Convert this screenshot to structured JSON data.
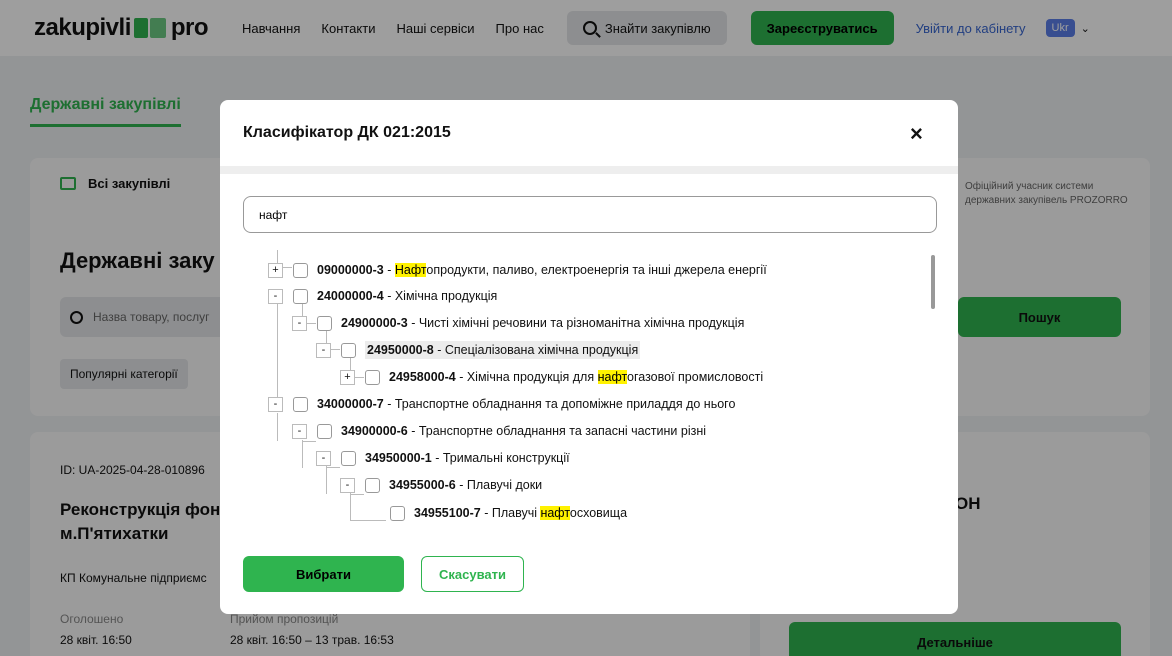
{
  "header": {
    "logo_left": "zakupivli",
    "logo_right": "pro",
    "nav": [
      "Навчання",
      "Контакти",
      "Наші сервіси",
      "Про нас"
    ],
    "find_button": "Знайти закупівлю",
    "register_button": "Зареєструватись",
    "login_link": "Увійти до кабінету",
    "language": "Ukr"
  },
  "page": {
    "tab_active": "Державні закупівлі",
    "all_tab": "Всі закупівлі",
    "title": "Державні заку",
    "search_placeholder": "Назва товару, послуг",
    "popular": "Популярні категорії",
    "official_line1": "Офіційний учасник системи",
    "official_line2": "державних закупівель PROZORRO",
    "search_button": "Пошук",
    "tender": {
      "id": "ID: UA-2025-04-28-010896",
      "title_line1": "Реконструкція фон",
      "title_line2": "м.П'ятихатки",
      "org": "КП Комунальне підприємс",
      "announced_label": "Оголошено",
      "announced_value": "28 квіт. 16:50",
      "receiving_label": "Прийом пропозицій",
      "receiving_value": "28 квіт. 16:50 – 13 трав. 16:53"
    },
    "side_heading": "ОН",
    "details_button": "Детальніше"
  },
  "modal": {
    "title": "Класифікатор ДК 021:2015",
    "close": "×",
    "search_value": "нафт",
    "tree": [
      {
        "code": "09000000-3",
        "pre": "",
        "hl": "Нафт",
        "post": "опродукти, паливо, електроенергія та інші джерела енергії",
        "exp": "+"
      },
      {
        "code": "24000000-4",
        "pre": "Хімічна продукція",
        "hl": "",
        "post": "",
        "exp": "-"
      },
      {
        "code": "24900000-3",
        "pre": "Чисті хімічні речовини та різноманітна хімічна продукція",
        "hl": "",
        "post": "",
        "exp": "-"
      },
      {
        "code": "24950000-8",
        "pre": "Спеціалізована хімічна продукція",
        "hl": "",
        "post": "",
        "exp": "-"
      },
      {
        "code": "24958000-4",
        "pre": "Хімічна продукція для ",
        "hl": "нафт",
        "post": "огазової промисловості",
        "exp": "+"
      },
      {
        "code": "34000000-7",
        "pre": "Транспортне обладнання та допоміжне приладдя до нього",
        "hl": "",
        "post": "",
        "exp": "-"
      },
      {
        "code": "34900000-6",
        "pre": "Транспортне обладнання та запасні частини різні",
        "hl": "",
        "post": "",
        "exp": "-"
      },
      {
        "code": "34950000-1",
        "pre": "Тримальні конструкції",
        "hl": "",
        "post": "",
        "exp": "-"
      },
      {
        "code": "34955000-6",
        "pre": "Плавучі доки",
        "hl": "",
        "post": "",
        "exp": "-"
      },
      {
        "code": "34955100-7",
        "pre": "Плавучі ",
        "hl": "нафт",
        "post": "осховища",
        "exp": ""
      }
    ],
    "choose_button": "Вибрати",
    "cancel_button": "Скасувати"
  }
}
